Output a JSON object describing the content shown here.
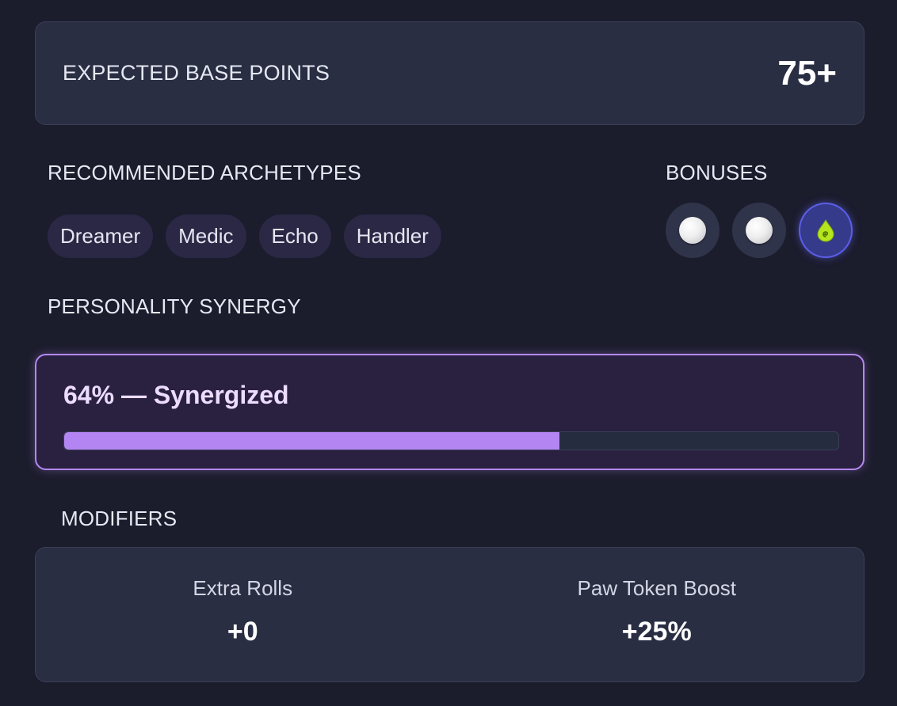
{
  "base_points": {
    "label": "EXPECTED BASE POINTS",
    "value": "75+"
  },
  "archetypes": {
    "heading": "RECOMMENDED ARCHETYPES",
    "items": [
      "Dreamer",
      "Medic",
      "Echo",
      "Handler"
    ]
  },
  "bonuses": {
    "heading": "BONUSES",
    "items": [
      {
        "icon": "white-orb-icon",
        "active": false
      },
      {
        "icon": "white-orb-icon",
        "active": false
      },
      {
        "icon": "green-droplet-icon",
        "active": true
      }
    ]
  },
  "synergy": {
    "heading": "PERSONALITY SYNERGY",
    "title": "64% — Synergized",
    "percent": 64,
    "bar_color": "#b385f2"
  },
  "modifiers": {
    "heading": "MODIFIERS",
    "items": [
      {
        "label": "Extra Rolls",
        "value": "+0"
      },
      {
        "label": "Paw Token Boost",
        "value": "+25%"
      }
    ]
  },
  "colors": {
    "background": "#1b1c2c",
    "card": "#292e43",
    "accent_purple": "#b488ef",
    "accent_indigo": "#5b5ee8",
    "droplet_green": "#b5e61d"
  }
}
